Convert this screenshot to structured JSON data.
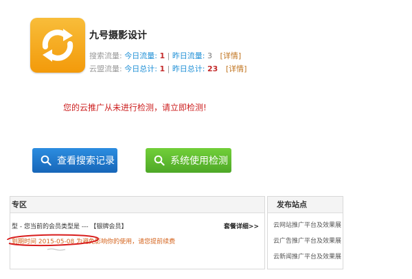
{
  "site": {
    "name": "九号摄影设计"
  },
  "stats": {
    "search": {
      "label": "搜索流量:",
      "today_label": "今日流量:",
      "today_value": "1",
      "yesterday_label": "昨日流量:",
      "yesterday_value": "3",
      "detail": "[详情]"
    },
    "cloud": {
      "label": "云盟流量:",
      "today_label": "今日总计:",
      "today_value": "1",
      "yesterday_label": "昨日总计:",
      "yesterday_value": "23",
      "detail": "[详情]"
    },
    "separator": "|"
  },
  "warning": "您的云推广从未进行检测，请立即检测!",
  "buttons": {
    "search_records": "查看搜索记录",
    "system_check": "系统使用检测"
  },
  "member_panel": {
    "title": "专区",
    "member_type_text": "型 - 您当前的会员类型是 --- 【",
    "member_type_value": "银牌会员",
    "member_type_close": "】",
    "package_link": "套餐详细>>",
    "expire_label": "到期时间",
    "expire_date": "2015-05-08",
    "expire_note": "为避免影响你的使用，请您提前续费"
  },
  "publish_panel": {
    "title": "发布站点",
    "items": [
      "云网站推广平台及效果展",
      "云广告推广平台及效果展",
      "云新闻推广平台及效果展"
    ]
  },
  "colors": {
    "accent_blue": "#1e8fd6",
    "value_red": "#c32a2a",
    "warning_red": "#cc1e1e",
    "button_blue": "#1f77cc",
    "button_green": "#5cba2f",
    "logo_orange": "#f5a51c"
  },
  "icons": {
    "logo": "refresh-arrows-icon",
    "button": "search-icon"
  }
}
